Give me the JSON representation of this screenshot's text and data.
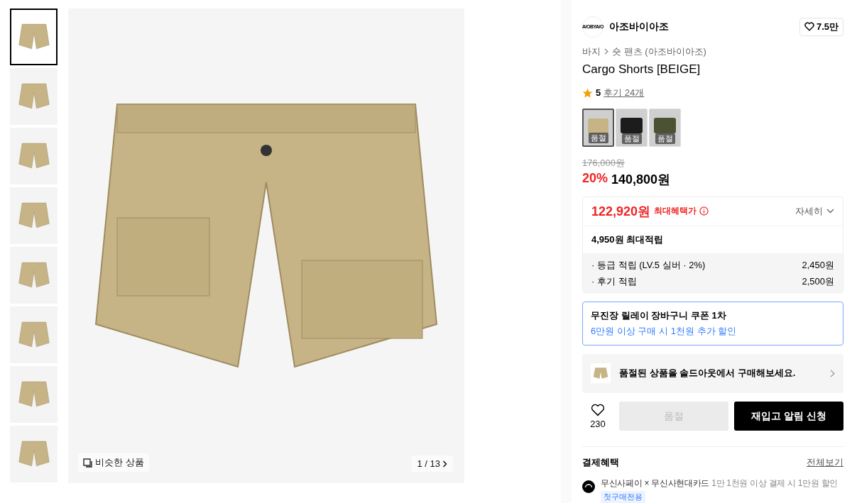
{
  "gallery": {
    "thumbnails": [
      {
        "selected": true
      },
      {
        "selected": false
      },
      {
        "selected": false
      },
      {
        "selected": false
      },
      {
        "selected": false
      },
      {
        "selected": false
      },
      {
        "selected": false
      },
      {
        "selected": false
      }
    ],
    "similar_button": "비슷한 상품",
    "counter": "1 / 13"
  },
  "brand": {
    "logo_text": "A/OBYA/O",
    "name": "아조바이아조",
    "likes": "7.5만"
  },
  "breadcrumb": [
    "바지",
    "숏 팬츠 (아조바이아조)"
  ],
  "title": "Cargo Shorts [BEIGE]",
  "rating": {
    "score": "5",
    "reviews": "후기 24개"
  },
  "swatches": [
    {
      "label": "품절",
      "color": "#c6b487",
      "selected": true
    },
    {
      "label": "품절",
      "color": "#1c1c1c",
      "selected": false
    },
    {
      "label": "품절",
      "color": "#4a5233",
      "selected": false
    }
  ],
  "price": {
    "original": "176,000원",
    "discount": "20%",
    "sale": "140,800원"
  },
  "benefit": {
    "max_price": "122,920원",
    "max_label": "최대혜택가",
    "details": "자세히",
    "points": "4,950원 최대적립",
    "rows": [
      {
        "label": "· 등급 적립 (LV.5 실버 · 2%)",
        "amount": "2,450원"
      },
      {
        "label": "· 후기 적립",
        "amount": "2,500원"
      }
    ]
  },
  "coupon": {
    "title": "무진장 릴레이 장바구니 쿠폰 1차",
    "subtitle": "6만원 이상 구매 시 1천원 추가 할인"
  },
  "soldout_banner": "품절된 상품을 솔드아웃에서 구매해보세요.",
  "actions": {
    "like_count": "230",
    "buy_button": {
      "label": "품절",
      "disabled": true
    },
    "restock_button": "재입고 알림 신청"
  },
  "payment": {
    "title": "결제혜택",
    "view_all": "전체보기",
    "offers": [
      {
        "partner": "무신사페이 × 무신사현대카드",
        "text": "1만 1천원 이상 결제 시 1만원 할인",
        "tag": "첫구매전용"
      }
    ]
  }
}
